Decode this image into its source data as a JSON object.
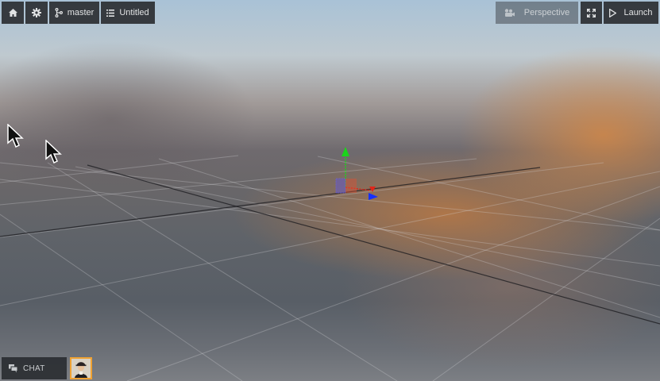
{
  "toolbar": {
    "home_icon": "home-icon",
    "settings_icon": "gear-icon",
    "branch_icon": "branch-icon",
    "branch_label": "master",
    "scene_icon": "list-icon",
    "scene_label": "Untitled",
    "camera_icon": "camera-icon",
    "camera_label": "Perspective",
    "fullscreen_icon": "expand-icon",
    "launch_icon": "play-icon",
    "launch_label": "Launch"
  },
  "chat": {
    "icon": "chat-icon",
    "label": "CHAT"
  },
  "viewport": {
    "gizmo_axis_colors": {
      "x": "#e0261a",
      "y": "#1bd51b",
      "z": "#1530ff"
    }
  },
  "colors": {
    "toolbar_bg": "#2c2f33",
    "avatar_border": "#f0a232"
  }
}
